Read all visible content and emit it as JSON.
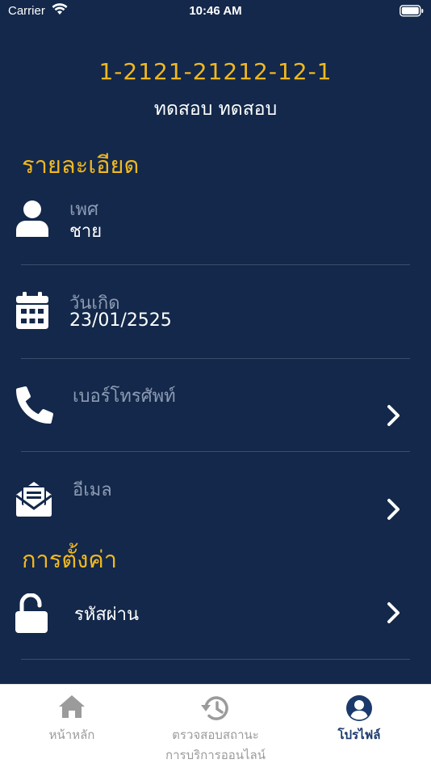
{
  "status_bar": {
    "carrier": "Carrier",
    "time": "10:46 AM"
  },
  "profile": {
    "member_id": "1-2121-21212-12-1",
    "name": "ทดสอบ  ทดสอบ"
  },
  "details": {
    "title": "รายละเอียด",
    "gender": {
      "label": "เพศ",
      "value": "ชาย",
      "icon": "person-icon"
    },
    "birthdate": {
      "label": "วันเกิด",
      "value": "23/01/2525",
      "icon": "calendar-icon"
    },
    "phone": {
      "label": "เบอร์โทรศัพท์",
      "icon": "phone-icon"
    },
    "email": {
      "label": "อีเมล",
      "icon": "envelope-icon"
    }
  },
  "settings": {
    "title": "การตั้งค่า",
    "password": {
      "label": "รหัสผ่าน",
      "icon": "unlock-icon"
    }
  },
  "tabs": [
    {
      "label": "หน้าหลัก",
      "icon": "home-icon",
      "active": false
    },
    {
      "label_line1": "ตรวจสอบสถานะ",
      "label_line2": "การบริการออนไลน์",
      "icon": "history-icon",
      "active": false
    },
    {
      "label": "โปรไฟล์",
      "icon": "user-circle-icon",
      "active": true
    }
  ],
  "colors": {
    "background": "#13284a",
    "accent": "#f2b81f",
    "muted_label": "#8d9bb3",
    "tab_active": "#1b3a6b",
    "tab_inactive": "#9b9b9b"
  }
}
